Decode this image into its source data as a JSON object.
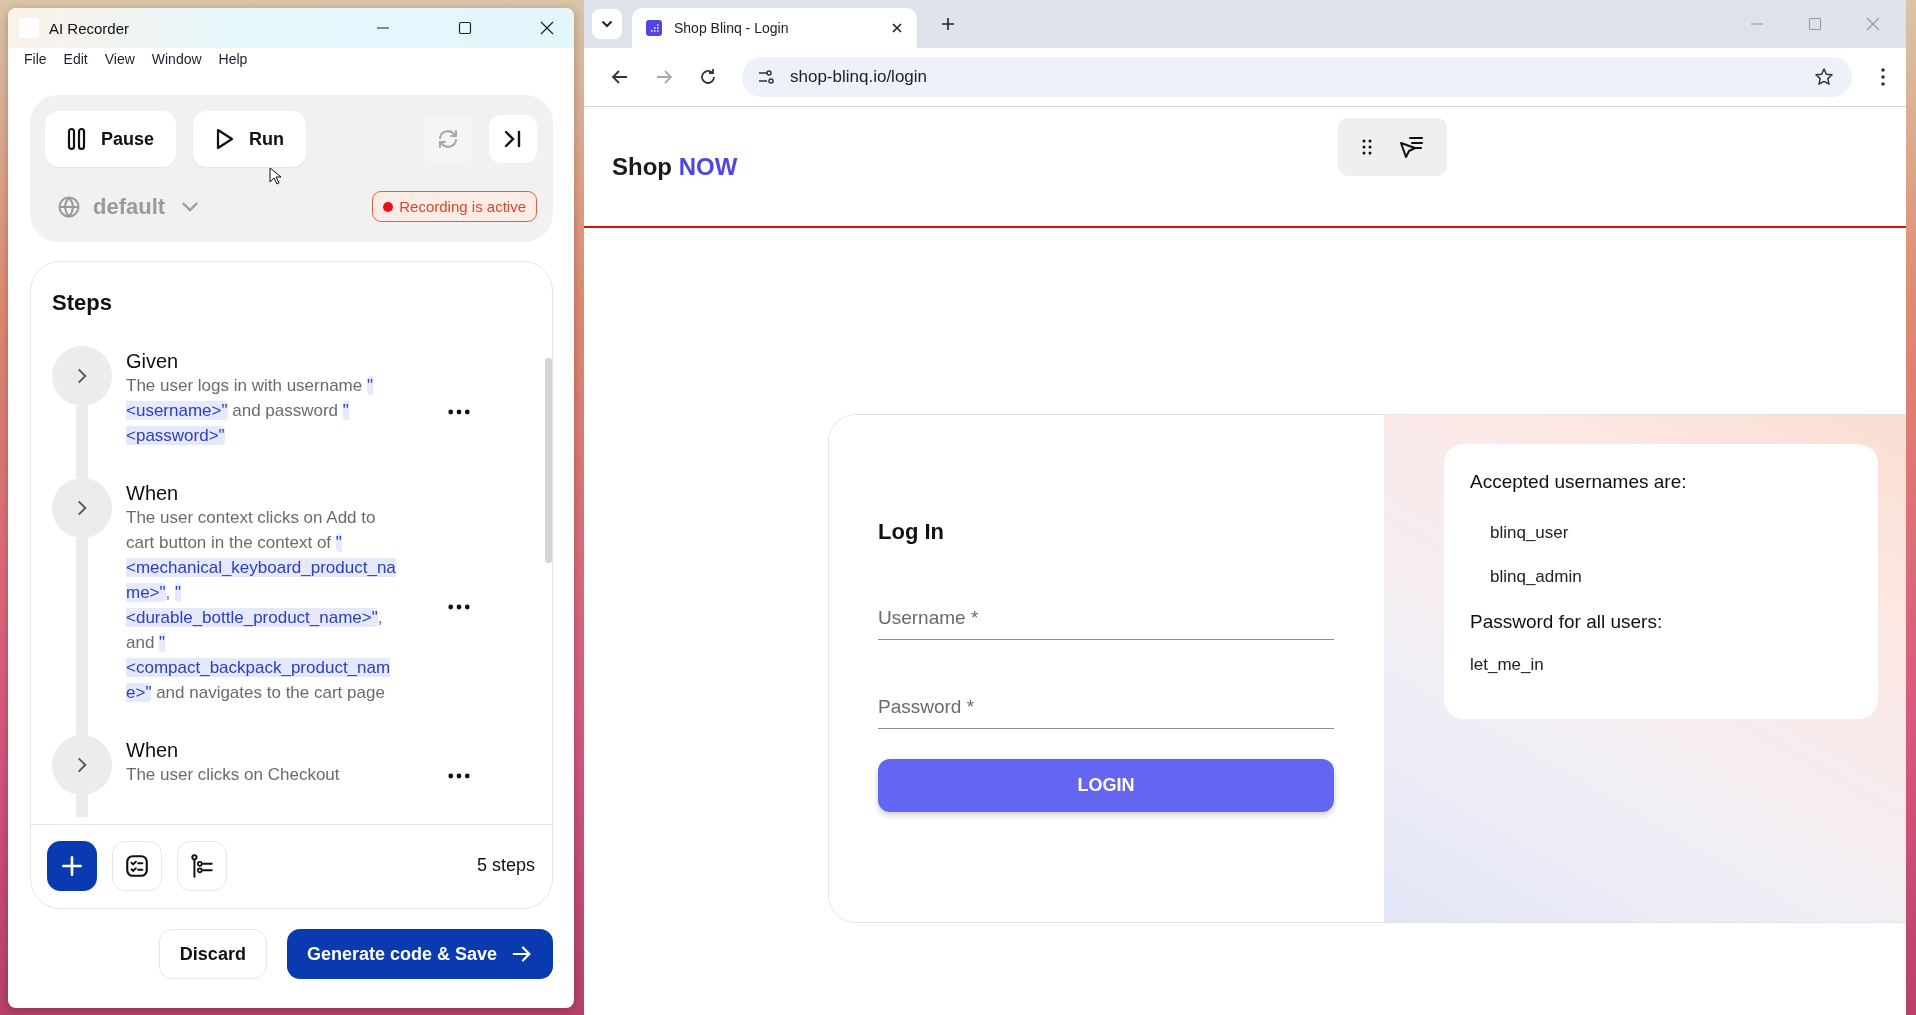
{
  "recorder": {
    "title": "AI Recorder",
    "menu": [
      "File",
      "Edit",
      "View",
      "Window",
      "Help"
    ],
    "controls": {
      "pause": "Pause",
      "run": "Run",
      "sync_disabled": true
    },
    "environment": "default",
    "recording": {
      "label": "Recording is active",
      "active": true
    },
    "steps_title": "Steps",
    "steps": [
      {
        "keyword": "Given",
        "description": [
          {
            "kind": "text",
            "text": "The user logs in with username "
          },
          {
            "kind": "param",
            "text": "\"<username>\""
          },
          {
            "kind": "text",
            "text": " and password "
          },
          {
            "kind": "param",
            "text": "\"<password>\""
          }
        ]
      },
      {
        "keyword": "When",
        "description": [
          {
            "kind": "text",
            "text": "The user context clicks on Add to cart button in the context of "
          },
          {
            "kind": "param",
            "text": "\"<mechanical_keyboard_product_name>\""
          },
          {
            "kind": "text",
            "text": ", "
          },
          {
            "kind": "param",
            "text": "\"<durable_bottle_product_name>\""
          },
          {
            "kind": "text",
            "text": ", and "
          },
          {
            "kind": "param",
            "text": "\"<compact_backpack_product_name>\""
          },
          {
            "kind": "text",
            "text": " and navigates to the cart page"
          }
        ]
      },
      {
        "keyword": "When",
        "description": [
          {
            "kind": "text",
            "text": "The user clicks on Checkout"
          }
        ]
      }
    ],
    "step_count": "5 steps",
    "discard": "Discard",
    "save": "Generate code & Save"
  },
  "browser": {
    "tab_title": "Shop Blinq - Login",
    "url": "shop-blinq.io/login",
    "forward_disabled": true,
    "page": {
      "brand": "Shop",
      "brand_accent": "NOW",
      "login": {
        "title": "Log In",
        "fields": [
          {
            "placeholder": "Username *"
          },
          {
            "placeholder": "Password *"
          }
        ],
        "button": "LOGIN"
      },
      "info": {
        "usernames_heading": "Accepted usernames are:",
        "usernames": [
          "blinq_user",
          "blinq_admin"
        ],
        "password_heading": "Password for all users:",
        "password": "let_me_in"
      }
    }
  }
}
